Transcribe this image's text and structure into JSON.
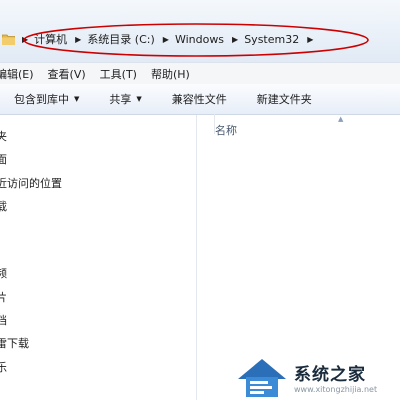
{
  "address_bar": {
    "breadcrumbs": [
      "计算机",
      "系统目录 (C:)",
      "Windows",
      "System32"
    ]
  },
  "menu": {
    "items": [
      "编辑(E)",
      "查看(V)",
      "工具(T)",
      "帮助(H)"
    ]
  },
  "toolbar": {
    "include_library": "包含到库中",
    "share": "共享",
    "compatibility_files": "兼容性文件",
    "new_folder": "新建文件夹"
  },
  "nav": {
    "items": [
      "夹",
      "面",
      "近访问的位置",
      "载",
      "频",
      "片",
      "档",
      "雷下载",
      "乐"
    ]
  },
  "content": {
    "name_column": "名称"
  },
  "watermark": {
    "text": "系统之家",
    "url": "www.xitongzhijia.net"
  },
  "colors": {
    "annotation_oval": "#cc0000",
    "folder": "#e8b84a"
  }
}
